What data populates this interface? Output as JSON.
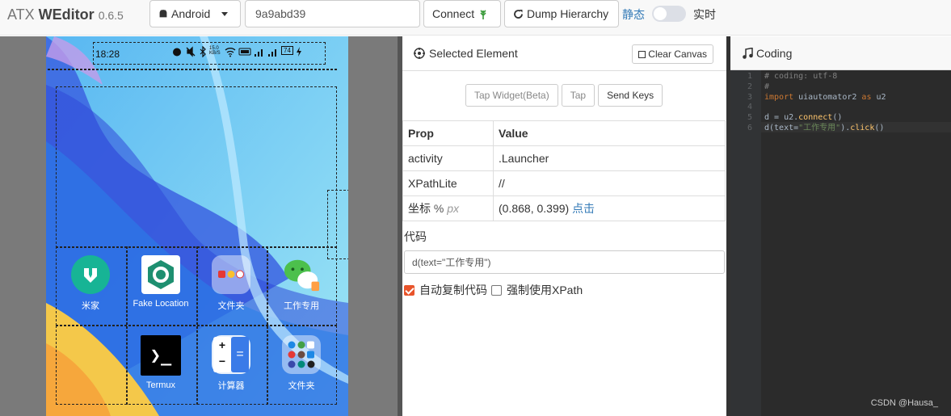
{
  "header": {
    "brand_prefix": "ATX ",
    "brand_name": "WEditor",
    "version": "0.6.5",
    "platform_select": "Android",
    "device_serial": "9a9abd39",
    "connect_label": "Connect",
    "dump_label": "Dump Hierarchy",
    "mode_static": "静态",
    "mode_live": "实时",
    "live_enabled": false
  },
  "phone": {
    "status_time": "18:28",
    "status_net": "15.0 KB/S",
    "status_battery": "74",
    "apps": [
      {
        "label": "米家",
        "icon": "mijia-icon"
      },
      {
        "label": "Fake Location",
        "icon": "fake-location-icon"
      },
      {
        "label": "文件夹",
        "icon": "folder-icon"
      },
      {
        "label": "工作专用",
        "icon": "wechat-work-icon"
      },
      {
        "label": "",
        "icon": "empty-slot"
      },
      {
        "label": "Termux",
        "icon": "termux-icon"
      },
      {
        "label": "计算器",
        "icon": "calculator-icon"
      },
      {
        "label": "文件夹",
        "icon": "folder-icon"
      }
    ],
    "termux_glyph": "❯_",
    "calc_glyph": "=",
    "calc_plus": "+",
    "calc_minus": "−"
  },
  "selected": {
    "title": "Selected Element",
    "clear_label": "Clear Canvas",
    "tap_widget": "Tap Widget(Beta)",
    "tap": "Tap",
    "send_keys": "Send Keys",
    "col_prop": "Prop",
    "col_value": "Value",
    "rows": [
      {
        "prop": "activity",
        "value": ".Launcher"
      },
      {
        "prop": "XPathLite",
        "value": "//"
      }
    ],
    "coord_prop": "坐标",
    "coord_pct": "%",
    "coord_px": "px",
    "coord_value": "(0.868, 0.399)",
    "coord_click": "点击",
    "code_label": "代码",
    "code_value": "d(text=\"工作专用\")",
    "auto_copy_label": "自动复制代码",
    "auto_copy": true,
    "force_xpath_label": "强制使用XPath",
    "force_xpath": false
  },
  "coding": {
    "title": "Coding",
    "lines": [
      {
        "n": "1",
        "t": "# coding: utf-8"
      },
      {
        "n": "2",
        "t": "#"
      },
      {
        "n": "3",
        "t": "import uiautomator2 as u2"
      },
      {
        "n": "4",
        "t": ""
      },
      {
        "n": "5",
        "t": "d = u2.connect()"
      },
      {
        "n": "6",
        "t": "d(text=\"工作专用\").click()"
      }
    ],
    "watermark": "CSDN @Hausa_"
  },
  "colors": {
    "link": "#337ab7",
    "accent_orange": "#e8542b",
    "editor_bg": "#2b2b2b",
    "keyword": "#cc7832",
    "string": "#6a8759"
  }
}
